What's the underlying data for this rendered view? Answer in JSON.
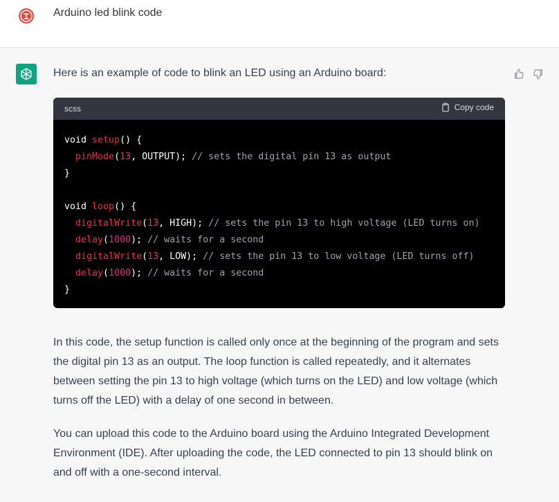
{
  "user": {
    "message": "Arduino led blink code"
  },
  "assistant": {
    "intro": "Here is an example of code to blink an LED using an Arduino board:",
    "code": {
      "language": "scss",
      "copy_label": "Copy code",
      "lines": [
        [
          {
            "t": "void ",
            "c": ""
          },
          {
            "t": "setup",
            "c": "fn"
          },
          {
            "t": "() {",
            "c": ""
          }
        ],
        [
          {
            "t": "  ",
            "c": ""
          },
          {
            "t": "pinMode",
            "c": "fn"
          },
          {
            "t": "(",
            "c": ""
          },
          {
            "t": "13",
            "c": "num"
          },
          {
            "t": ", OUTPUT); ",
            "c": ""
          },
          {
            "t": "// sets the digital pin 13 as output",
            "c": "cm"
          }
        ],
        [
          {
            "t": "}",
            "c": ""
          }
        ],
        [],
        [
          {
            "t": "void ",
            "c": ""
          },
          {
            "t": "loop",
            "c": "fn"
          },
          {
            "t": "() {",
            "c": ""
          }
        ],
        [
          {
            "t": "  ",
            "c": ""
          },
          {
            "t": "digitalWrite",
            "c": "fn"
          },
          {
            "t": "(",
            "c": ""
          },
          {
            "t": "13",
            "c": "num"
          },
          {
            "t": ", HIGH); ",
            "c": ""
          },
          {
            "t": "// sets the pin 13 to high voltage (LED turns on)",
            "c": "cm"
          }
        ],
        [
          {
            "t": "  ",
            "c": ""
          },
          {
            "t": "delay",
            "c": "fn"
          },
          {
            "t": "(",
            "c": ""
          },
          {
            "t": "1000",
            "c": "num"
          },
          {
            "t": "); ",
            "c": ""
          },
          {
            "t": "// waits for a second",
            "c": "cm"
          }
        ],
        [
          {
            "t": "  ",
            "c": ""
          },
          {
            "t": "digitalWrite",
            "c": "fn"
          },
          {
            "t": "(",
            "c": ""
          },
          {
            "t": "13",
            "c": "num"
          },
          {
            "t": ", LOW); ",
            "c": ""
          },
          {
            "t": "// sets the pin 13 to low voltage (LED turns off)",
            "c": "cm"
          }
        ],
        [
          {
            "t": "  ",
            "c": ""
          },
          {
            "t": "delay",
            "c": "fn"
          },
          {
            "t": "(",
            "c": ""
          },
          {
            "t": "1000",
            "c": "num"
          },
          {
            "t": "); ",
            "c": ""
          },
          {
            "t": "// waits for a second",
            "c": "cm"
          }
        ],
        [
          {
            "t": "}",
            "c": ""
          }
        ]
      ]
    },
    "paragraphs": [
      "In this code, the setup function is called only once at the beginning of the program and sets the digital pin 13 as an output. The loop function is called repeatedly, and it alternates between setting the pin 13 to high voltage (which turns on the LED) and low voltage (which turns off the LED) with a delay of one second in between.",
      "You can upload this code to the Arduino board using the Arduino Integrated Development Environment (IDE). After uploading the code, the LED connected to pin 13 should blink on and off with a one-second interval."
    ],
    "feedback": {
      "thumbs_up_icon": "thumbs-up-icon",
      "thumbs_down_icon": "thumbs-down-icon"
    }
  },
  "colors": {
    "accent": "#10a37f",
    "code_bg": "#000000",
    "code_header_bg": "#343541",
    "function": "#f22c3d",
    "number": "#df3079",
    "comment": "#9ca3af"
  }
}
